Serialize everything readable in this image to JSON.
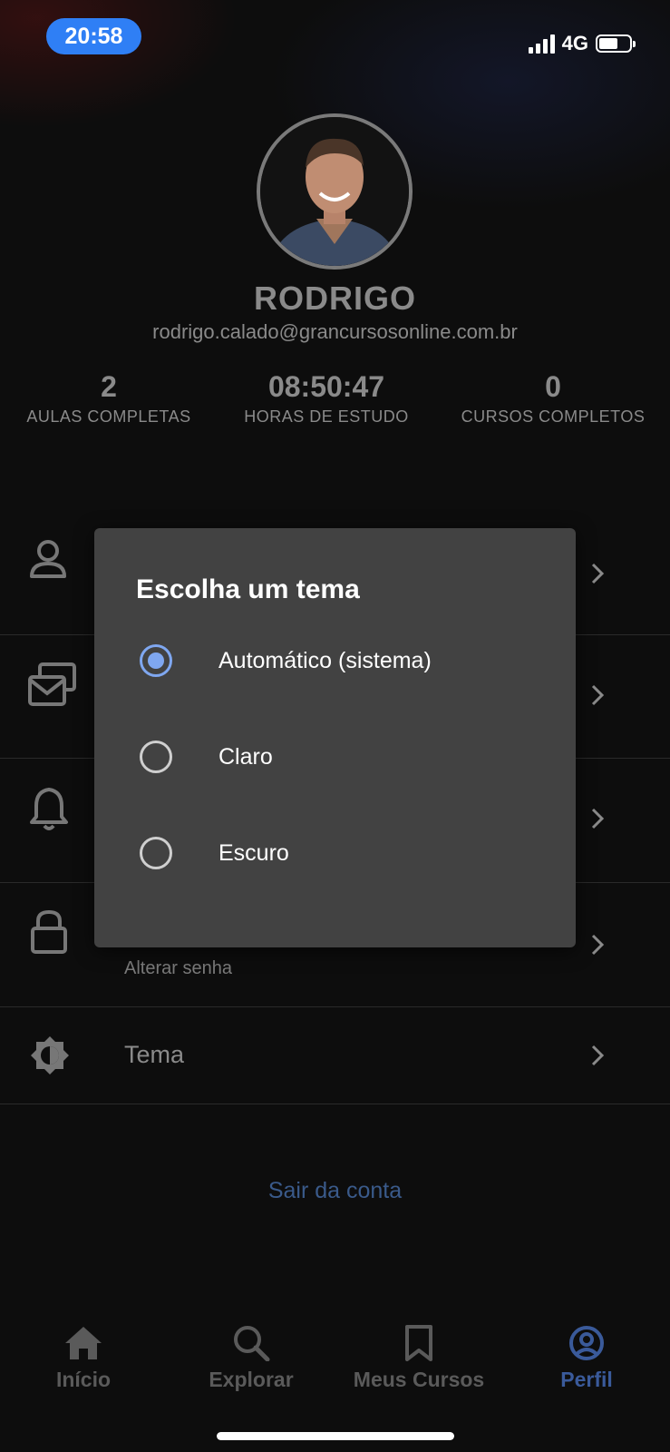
{
  "status_bar": {
    "time": "20:58",
    "network": "4G",
    "battery_level": 0.55
  },
  "profile": {
    "name": "RODRIGO",
    "email": "rodrigo.calado@grancursosonline.com.br",
    "stats": [
      {
        "value": "2",
        "label": "AULAS COMPLETAS"
      },
      {
        "value": "08:50:47",
        "label": "HORAS DE ESTUDO"
      },
      {
        "value": "0",
        "label": "CURSOS COMPLETOS"
      }
    ]
  },
  "menu": {
    "items": [
      {
        "icon": "user-icon"
      },
      {
        "icon": "mail-icon"
      },
      {
        "icon": "bell-icon"
      },
      {
        "icon": "lock-icon",
        "subtitle": "Alterar senha"
      },
      {
        "icon": "theme-icon",
        "label": "Tema"
      }
    ]
  },
  "logout_label": "Sair da conta",
  "bottom_nav": [
    {
      "icon": "home-icon",
      "label": "Início"
    },
    {
      "icon": "search-icon",
      "label": "Explorar"
    },
    {
      "icon": "bookmark-icon",
      "label": "Meus Cursos"
    },
    {
      "icon": "profile-icon",
      "label": "Perfil",
      "active": true
    }
  ],
  "theme_dialog": {
    "title": "Escolha um tema",
    "options": [
      {
        "label": "Automático (sistema)",
        "selected": true
      },
      {
        "label": "Claro",
        "selected": false
      },
      {
        "label": "Escuro",
        "selected": false
      }
    ]
  },
  "colors": {
    "accent": "#7fa7f0",
    "dialog_bg": "#424242",
    "time_pill": "#2f7ff5",
    "nav_active": "#3a5a9a"
  }
}
